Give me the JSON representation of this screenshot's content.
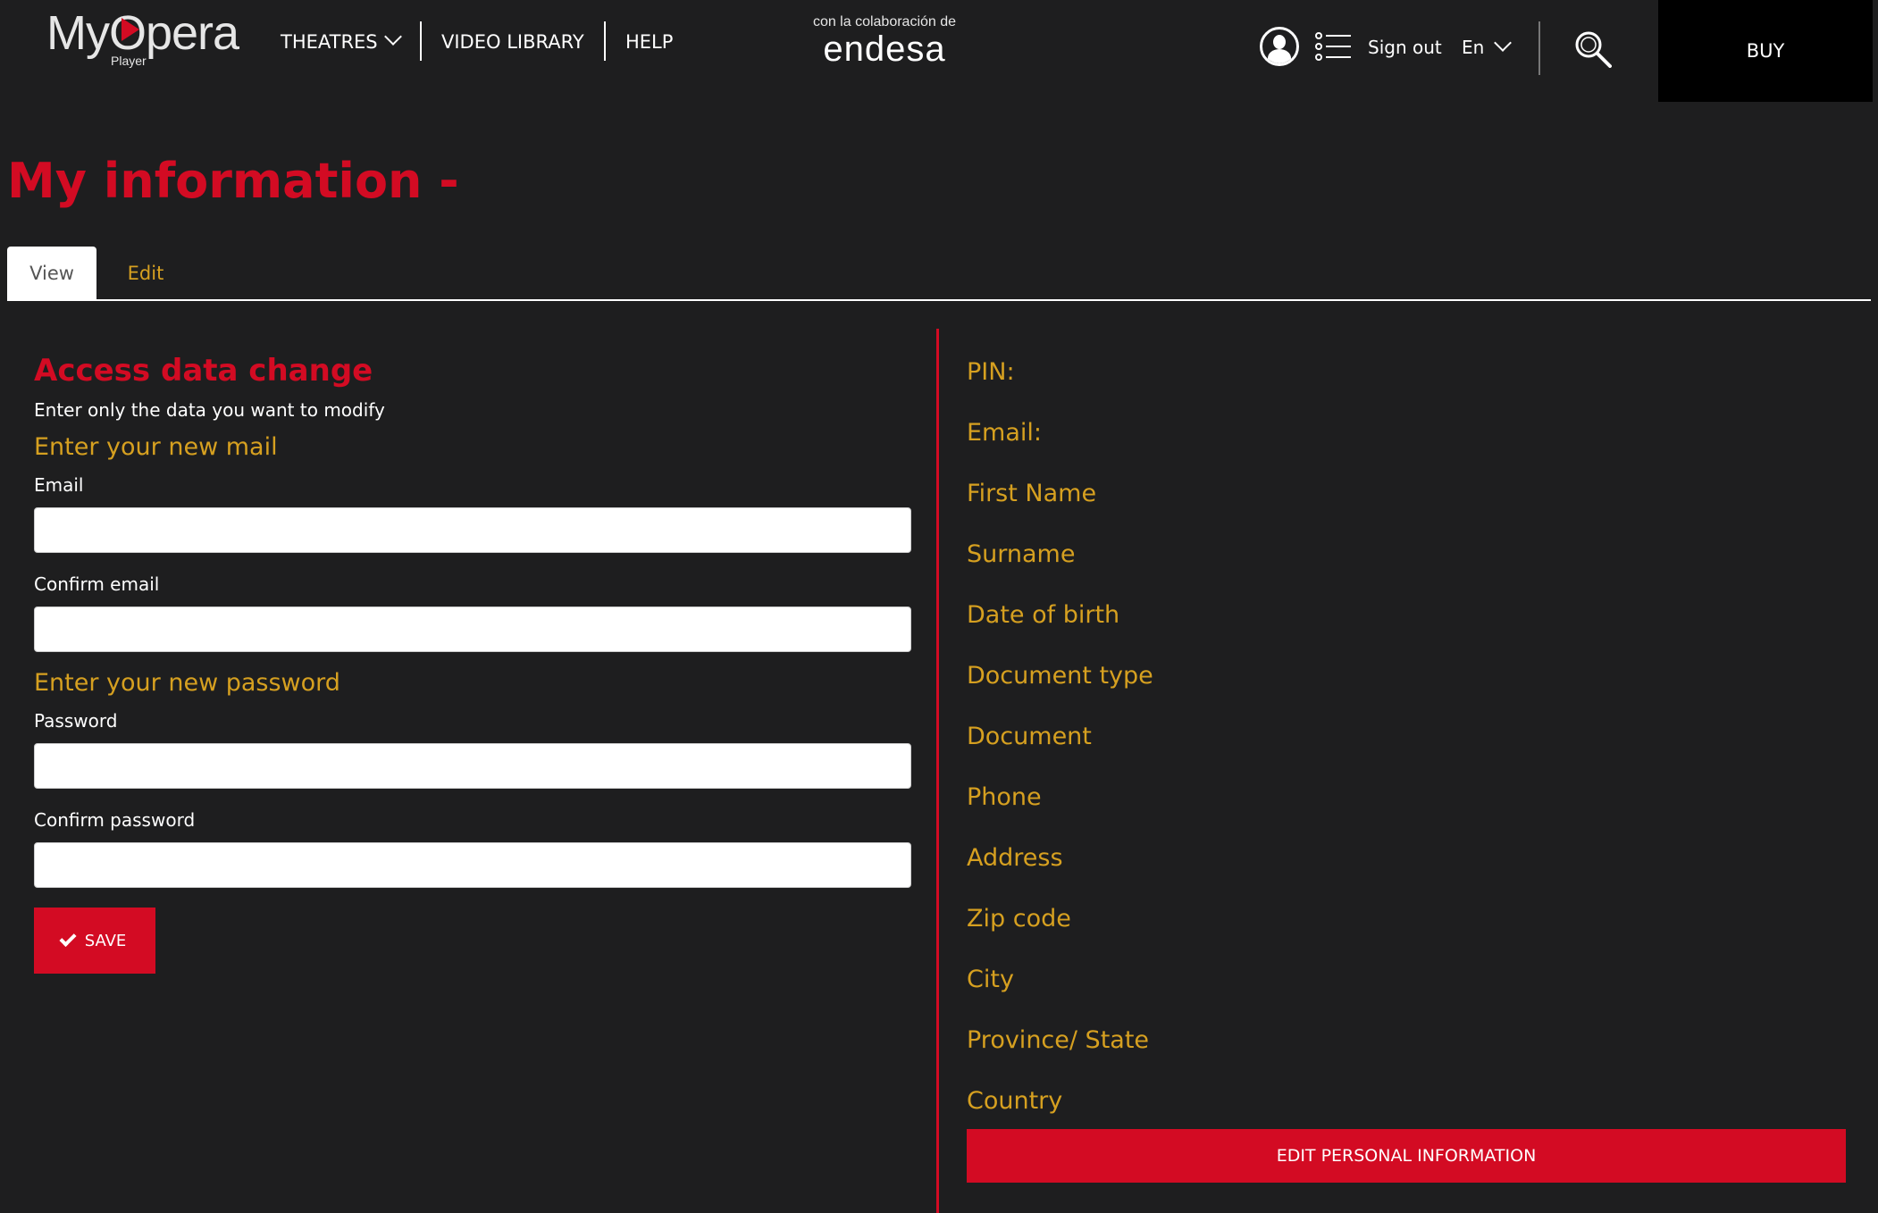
{
  "header": {
    "logo_text": "MyOpera",
    "logo_sub": "Player",
    "nav": {
      "theatres": "THEATRES",
      "video_library": "VIDEO LIBRARY",
      "help": "HELP"
    },
    "sponsor_top": "con la colaboración de",
    "sponsor_brand": "endesa",
    "sign_out": "Sign out",
    "language": "En",
    "buy": "BUY"
  },
  "page": {
    "title": "My information -"
  },
  "tabs": [
    {
      "label": "View",
      "active": true
    },
    {
      "label": "Edit",
      "active": false
    }
  ],
  "access": {
    "title": "Access data change",
    "hint": "Enter only the data you want to modify",
    "mail_group": "Enter your new mail",
    "email_label": "Email",
    "email_value": "",
    "confirm_email_label": "Confirm email",
    "confirm_email_value": "",
    "password_group": "Enter your new password",
    "password_label": "Password",
    "password_value": "",
    "confirm_password_label": "Confirm password",
    "confirm_password_value": "",
    "save": "SAVE"
  },
  "personal": {
    "fields": [
      "PIN:",
      "Email:",
      "First Name",
      "Surname",
      "Date of birth",
      "Document type",
      "Document",
      "Phone",
      "Address",
      "Zip code",
      "City",
      "Province/ State",
      "Country"
    ],
    "edit_button": "EDIT PERSONAL INFORMATION"
  },
  "colors": {
    "accent_red": "#d30b23",
    "label_gold": "#d6a020",
    "background": "#1e1e1f"
  }
}
